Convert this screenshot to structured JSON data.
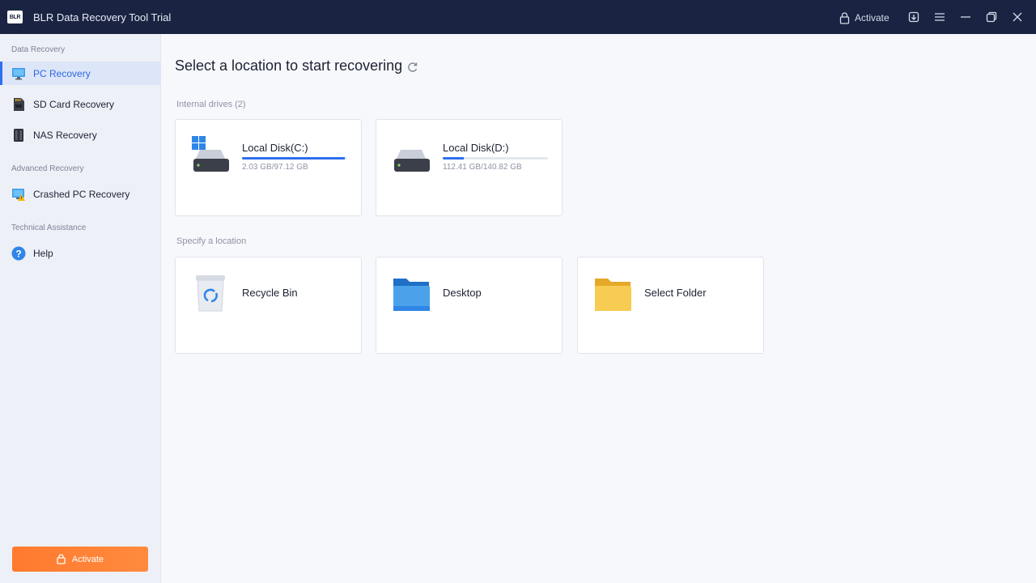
{
  "window": {
    "title": "BLR Data Recovery Tool Trial",
    "logo_text": "BLR",
    "activate_label": "Activate"
  },
  "sidebar": {
    "sections": [
      {
        "label": "Data Recovery"
      },
      {
        "label": "Advanced Recovery"
      },
      {
        "label": "Technical Assistance"
      }
    ],
    "items": [
      {
        "label": "PC Recovery",
        "icon": "monitor-icon",
        "active": true
      },
      {
        "label": "SD Card Recovery",
        "icon": "sd-card-icon",
        "active": false
      },
      {
        "label": "NAS Recovery",
        "icon": "nas-icon",
        "active": false
      },
      {
        "label": "Crashed PC Recovery",
        "icon": "crashed-pc-icon",
        "active": false
      },
      {
        "label": "Help",
        "icon": "help-icon",
        "active": false
      }
    ],
    "activate_button": "Activate"
  },
  "main": {
    "title": "Select a location to start recovering",
    "internal_label": "Internal drives (2)",
    "drives": [
      {
        "name": "Local Disk(C:)",
        "size": "2.03 GB/97.12 GB",
        "usage_fraction": 0.98,
        "icon": "drive-windows-icon"
      },
      {
        "name": "Local Disk(D:)",
        "size": "112.41 GB/140.82 GB",
        "usage_fraction": 0.2,
        "icon": "drive-icon"
      }
    ],
    "specify_label": "Specify a location",
    "locations": [
      {
        "name": "Recycle Bin",
        "icon": "recycle-bin-icon"
      },
      {
        "name": "Desktop",
        "icon": "desktop-folder-icon"
      },
      {
        "name": "Select Folder",
        "icon": "folder-icon"
      }
    ]
  },
  "colors": {
    "titlebar": "#1a2341",
    "accent": "#2f6ff0",
    "activate_button": "#ff7a2f"
  }
}
